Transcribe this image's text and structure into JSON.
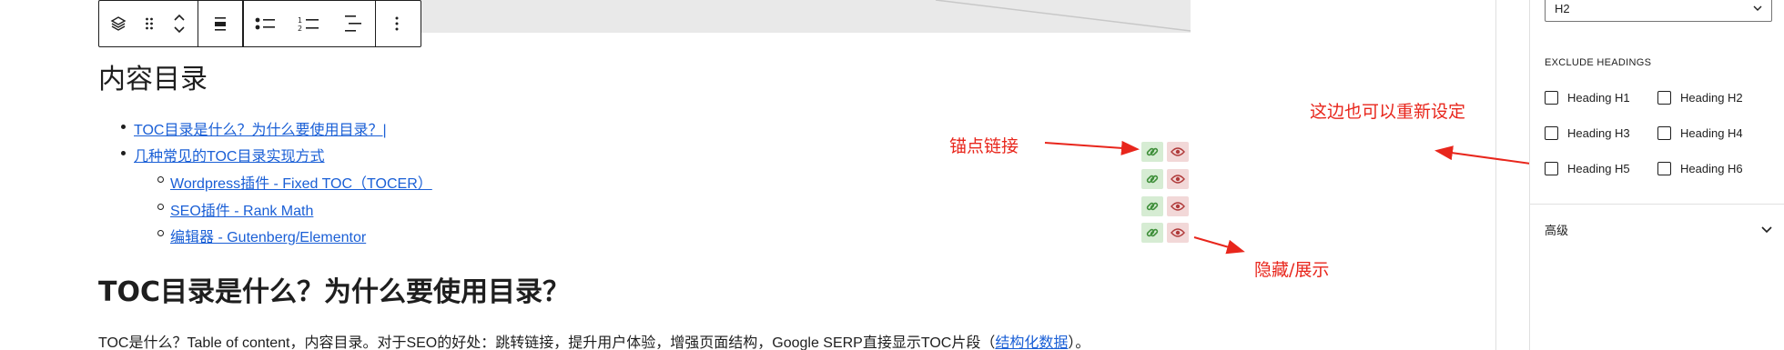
{
  "toc": {
    "heading": "内容目录",
    "items": [
      {
        "label": "TOC目录是什么？为什么要使用目录？|",
        "level": 1
      },
      {
        "label": "几种常见的TOC目录实现方式",
        "level": 1
      },
      {
        "label": "Wordpress插件 - Fixed TOC（TOCER）",
        "level": 2
      },
      {
        "label": "SEO插件 - Rank Math",
        "level": 2
      },
      {
        "label": "编辑器 - Gutenberg/Elementor",
        "level": 2
      }
    ]
  },
  "annotations": {
    "anchor_link": "锚点链接",
    "hide_show": "隐藏/展示",
    "reset_here": "这边也可以重新设定"
  },
  "content": {
    "h2": "TOC目录是什么？为什么要使用目录？",
    "paragraph_prefix": "TOC是什么？Table of content，内容目录。对于SEO的好处：跳转链接，提升用户体验，增强页面结构，Google SERP直接显示TOC片段（",
    "paragraph_link": "结构化数据",
    "paragraph_suffix": "）。"
  },
  "sidebar": {
    "heading_select_value": "H2",
    "exclude_label": "EXCLUDE HEADINGS",
    "checkboxes": [
      "Heading H1",
      "Heading H2",
      "Heading H3",
      "Heading H4",
      "Heading H5",
      "Heading H6"
    ],
    "advanced_label": "高级"
  },
  "colors": {
    "link": "#1a5fd6",
    "annotation": "#e8261c",
    "link_icon_bg": "#d6ecd3",
    "eye_icon_bg": "#f2d8d8"
  }
}
